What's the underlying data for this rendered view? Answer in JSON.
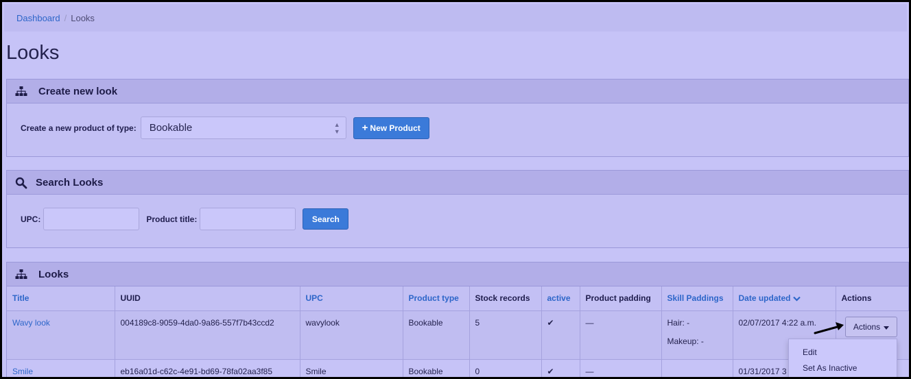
{
  "breadcrumb": {
    "home": "Dashboard",
    "separator": "/",
    "current": "Looks"
  },
  "page_title": "Looks",
  "create_panel": {
    "title": "Create new look",
    "label": "Create a new product of type:",
    "selected_type": "Bookable",
    "button": "New Product",
    "button_icon": "+"
  },
  "search_panel": {
    "title": "Search Looks",
    "upc_label": "UPC:",
    "upc_value": "",
    "title_label": "Product title:",
    "title_value": "",
    "button": "Search"
  },
  "looks_panel": {
    "title": "Looks",
    "columns": [
      {
        "label": "Title",
        "sortable": true
      },
      {
        "label": "UUID",
        "sortable": false
      },
      {
        "label": "UPC",
        "sortable": true
      },
      {
        "label": "Product type",
        "sortable": true
      },
      {
        "label": "Stock records",
        "sortable": false
      },
      {
        "label": "active",
        "sortable": true
      },
      {
        "label": "Product padding",
        "sortable": false
      },
      {
        "label": "Skill Paddings",
        "sortable": true
      },
      {
        "label": "Date updated",
        "sortable": true
      },
      {
        "label": "Actions",
        "sortable": false
      }
    ],
    "rows": [
      {
        "title": "Wavy look",
        "uuid": "004189c8-9059-4da0-9a86-557f7b43ccd2",
        "upc": "wavylook",
        "product_type": "Bookable",
        "stock_records": "5",
        "active": "✔",
        "product_padding": "—",
        "skill_hair": "Hair: -",
        "skill_makeup": "Makeup: -",
        "date_updated": "02/07/2017 4:22 a.m."
      },
      {
        "title": "Smile",
        "uuid": "eb16a01d-c62c-4e91-bd69-78fa02aa3f85",
        "upc": "Smile",
        "product_type": "Bookable",
        "stock_records": "0",
        "active": "✔",
        "product_padding": "—",
        "skill_hair": "",
        "skill_makeup": "",
        "date_updated": "01/31/2017 3"
      }
    ],
    "actions_button": "Actions",
    "actions_menu": [
      "Edit",
      "Set As Inactive"
    ]
  },
  "colors": {
    "link": "#2d66c9",
    "primary_button": "#3b7ad9",
    "background": "#c6c3f7"
  }
}
